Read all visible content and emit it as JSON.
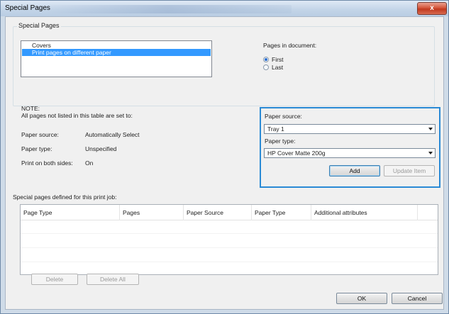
{
  "window": {
    "title": "Special Pages",
    "close_glyph": "x"
  },
  "group": {
    "label": "Special Pages",
    "list_items": [
      "Covers",
      "Print pages on different paper"
    ],
    "selected_index": 1
  },
  "pages_in_document": {
    "label": "Pages in document:",
    "options": [
      "First",
      "Last"
    ],
    "selected": "First"
  },
  "note": {
    "title": "NOTE:",
    "text": "All pages not listed in this table are set to:",
    "settings": [
      {
        "label": "Paper source:",
        "value": "Automatically Select"
      },
      {
        "label": "Paper type:",
        "value": "Unspecified"
      },
      {
        "label": "Print on both sides:",
        "value": "On"
      }
    ]
  },
  "paper_panel": {
    "source_label": "Paper source:",
    "source_value": "Tray 1",
    "type_label": "Paper type:",
    "type_value": "HP Cover Matte 200g",
    "add_label": "Add",
    "update_label": "Update Item",
    "highlight_color": "#2a8ad5"
  },
  "special_pages": {
    "label": "Special pages defined for this print job:",
    "columns": [
      "Page Type",
      "Pages",
      "Paper Source",
      "Paper Type",
      "Additional attributes"
    ],
    "rows": []
  },
  "buttons": {
    "delete": "Delete",
    "delete_all": "Delete All",
    "ok": "OK",
    "cancel": "Cancel"
  }
}
